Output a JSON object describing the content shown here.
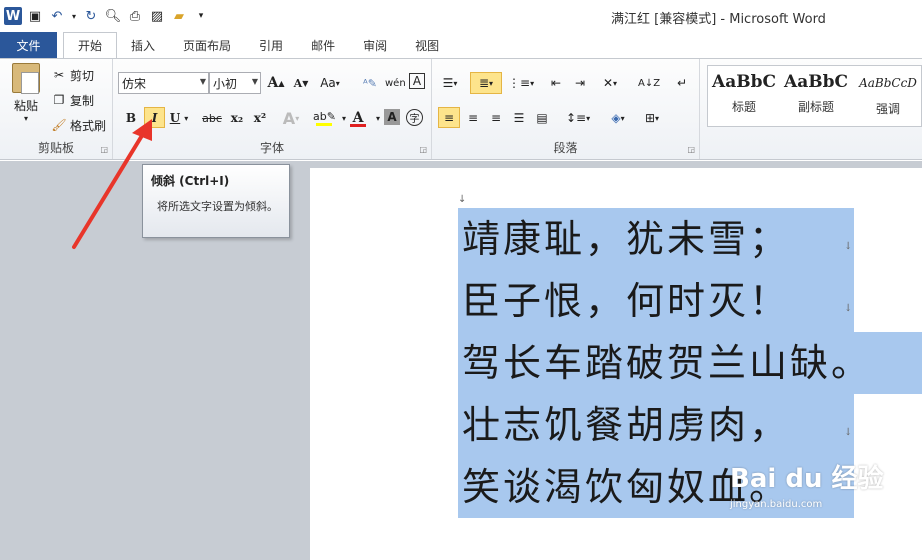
{
  "window": {
    "title": "满江红 [兼容模式] - Microsoft Word"
  },
  "tabs": [
    {
      "label": "文件"
    },
    {
      "label": "开始"
    },
    {
      "label": "插入"
    },
    {
      "label": "页面布局"
    },
    {
      "label": "引用"
    },
    {
      "label": "邮件"
    },
    {
      "label": "审阅"
    },
    {
      "label": "视图"
    }
  ],
  "clipboard": {
    "paste": "粘贴",
    "cut": "剪切",
    "copy": "复制",
    "format_painter": "格式刷",
    "group": "剪贴板"
  },
  "font": {
    "name": "仿宋",
    "size": "小初",
    "group": "字体",
    "bold": "B",
    "italic": "I",
    "underline": "U",
    "strike": "abc",
    "subscript": "x₂",
    "superscript": "x²",
    "grow": "A",
    "shrink": "A",
    "case": "Aa",
    "clear": "A",
    "highlight_color": "#ffff00",
    "font_color": "#e02020"
  },
  "paragraph": {
    "group": "段落"
  },
  "styles": [
    {
      "sample": "AaBbC",
      "name": "标题"
    },
    {
      "sample": "AaBbC",
      "name": "副标题"
    },
    {
      "sample": "AaBbCcD",
      "name": "强调"
    }
  ],
  "tooltip": {
    "title": "倾斜 (Ctrl+I)",
    "body": "将所选文字设置为倾斜。"
  },
  "document": {
    "lines": [
      "靖康耻，犹未雪；",
      "臣子恨，何时灭！",
      "驾长车踏破贺兰山缺。",
      "壮志饥餐胡虏肉，",
      "笑谈渴饮匈奴血。"
    ],
    "paragraph_mark": "↓"
  },
  "watermark": {
    "brand": "Bai du 经验",
    "url": "jingyan.baidu.com"
  },
  "colors": {
    "accent": "#2b579a",
    "selection": "#a8c8ee",
    "arrow": "#e8352a"
  }
}
